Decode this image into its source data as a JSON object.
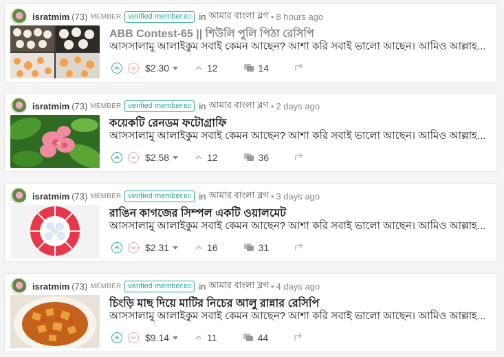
{
  "posts": [
    {
      "author": "isratmim",
      "reputation": "(73)",
      "role": "MEMBER",
      "badge": "verified member",
      "badge_suffix": "BD",
      "in_label": "in",
      "community": "আমার বাংলা ব্লগ",
      "time": "8 hours ago",
      "title": "ABB Contest-65 || শিউলি পুলি পিঠা রেসিপি",
      "excerpt": "আসসালামু আলাইকুম সবাই কেমন আছেন? আশা করি সবাই ভালো আছেন। আমিও আল্লাহ...",
      "payout": "$2.30",
      "votes": "12",
      "replies": "14",
      "thumb": "pitha-icon"
    },
    {
      "author": "isratmim",
      "reputation": "(73)",
      "role": "MEMBER",
      "badge": "verified member",
      "badge_suffix": "BD",
      "in_label": "in",
      "community": "আমার বাংলা ব্লগ",
      "time": "2 days ago",
      "title": "কয়েকটি রেনডম ফটোগ্রাফি",
      "excerpt": "আসসালামু আলাইকুম সবাই কেমন আছেন? আশা করি সবাই ভালো আছেন। আমিও আল্লাহ...",
      "payout": "$2.58",
      "votes": "12",
      "replies": "36",
      "thumb": "flower-icon"
    },
    {
      "author": "isratmim",
      "reputation": "(73)",
      "role": "MEMBER",
      "badge": "verified member",
      "badge_suffix": "BD",
      "in_label": "in",
      "community": "আমার বাংলা ব্লগ",
      "time": "3 days ago",
      "title": "রাঙিন কাগজের সিম্পল একটি ওয়ালমেট",
      "excerpt": "আসসালামু আলাইকুম সবাই কেমন আছেন? আশা করি সবাই ভালো আছেন। আমিও আল্লাহ...",
      "payout": "$2.31",
      "votes": "16",
      "replies": "31",
      "thumb": "wallmat-icon"
    },
    {
      "author": "isratmim",
      "reputation": "(73)",
      "role": "MEMBER",
      "badge": "verified member",
      "badge_suffix": "BD",
      "in_label": "in",
      "community": "আমার বাংলা ব্লগ",
      "time": "4 days ago",
      "title": "চিংড়ি মাছ দিয়ে মাটির নিচের আলু রান্নার রেসিপি",
      "excerpt": "আসসালামু আলাইকুম সবাই কেমন আছেন? আশা করি সবাই ভালো আছেন। আমিও আল্লাহ...",
      "payout": "$9.14",
      "votes": "11",
      "replies": "44",
      "thumb": "curry-icon"
    }
  ],
  "colors": {
    "accent": "#26a69a",
    "downvote": "#f0a0a0",
    "visited_title": "#888888"
  }
}
